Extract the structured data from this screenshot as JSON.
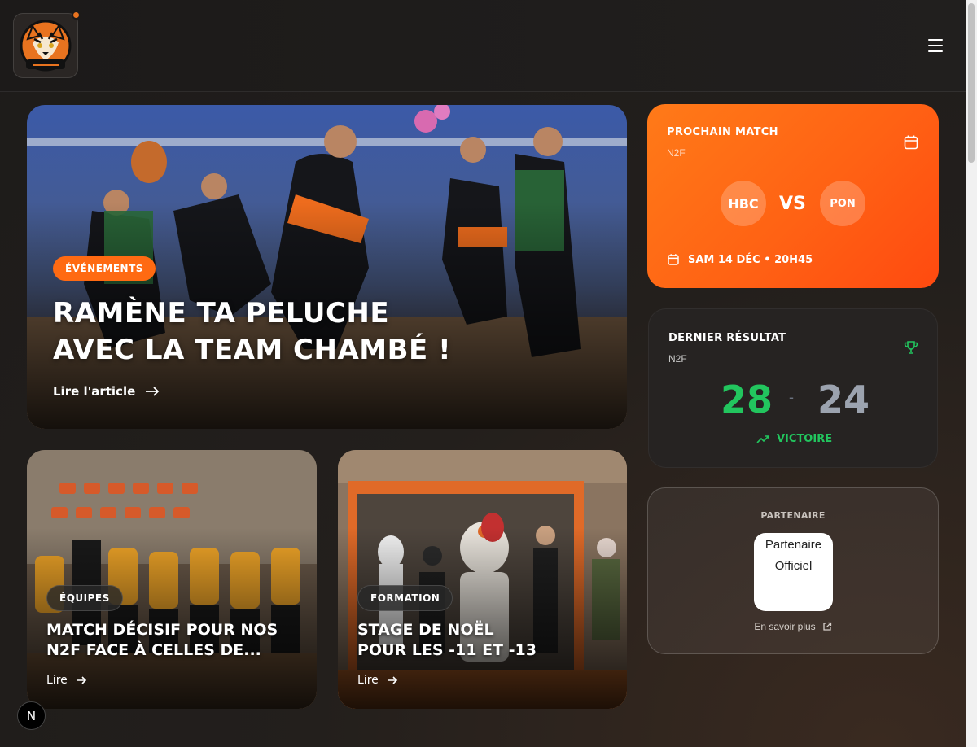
{
  "header": {
    "logo_alt": "Handball Club Aix-en-Savoie",
    "menu_icon": "menu-icon"
  },
  "hero": {
    "category": "ÉVÉNEMENTS",
    "title_line1": "RAMÈNE TA PELUCHE",
    "title_line2": "AVEC LA TEAM CHAMBÉ !",
    "read_label": "Lire l'article"
  },
  "articles": [
    {
      "category": "ÉQUIPES",
      "title_line1": "MATCH DÉCISIF POUR NOS",
      "title_line2": "N2F FACE À CELLES DE...",
      "read_label": "Lire"
    },
    {
      "category": "FORMATION",
      "title_line1": "STAGE DE NOËL",
      "title_line2": "POUR LES -11 ET -13",
      "read_label": "Lire"
    }
  ],
  "next_match": {
    "heading": "PROCHAIN MATCH",
    "division": "N2F",
    "home": "HBC",
    "vs": "VS",
    "away": "PON",
    "datetime": "SAM 14 DÉC • 20H45"
  },
  "last_result": {
    "heading": "DERNIER RÉSULTAT",
    "division": "N2F",
    "home_score": "28",
    "separator": "-",
    "away_score": "24",
    "verdict": "VICTOIRE"
  },
  "partner": {
    "heading": "PARTENAIRE",
    "image_alt": "Partenaire Officiel",
    "link_label": "En savoir plus"
  },
  "dev_badge": "N",
  "colors": {
    "accent": "#ff6a12",
    "win": "#22c55e",
    "loss": "#9ca3af",
    "background": "#1d1b1a"
  }
}
